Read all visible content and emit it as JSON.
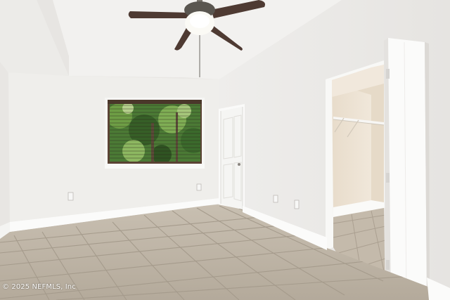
{
  "watermark": {
    "text": "© 2025 NEFMLS, Inc"
  },
  "colors": {
    "wall_light": "#f0efed",
    "wall_shadow": "#e3e1de",
    "ceiling": "#f4f3f1",
    "floor_tile": "#bdb3a4",
    "grout": "#a89e8f",
    "baseboard": "#fbfbfa",
    "foliage": "#3f6b2f",
    "closet_wall": "#ede2d2",
    "fan_blade": "#4e3a32"
  }
}
